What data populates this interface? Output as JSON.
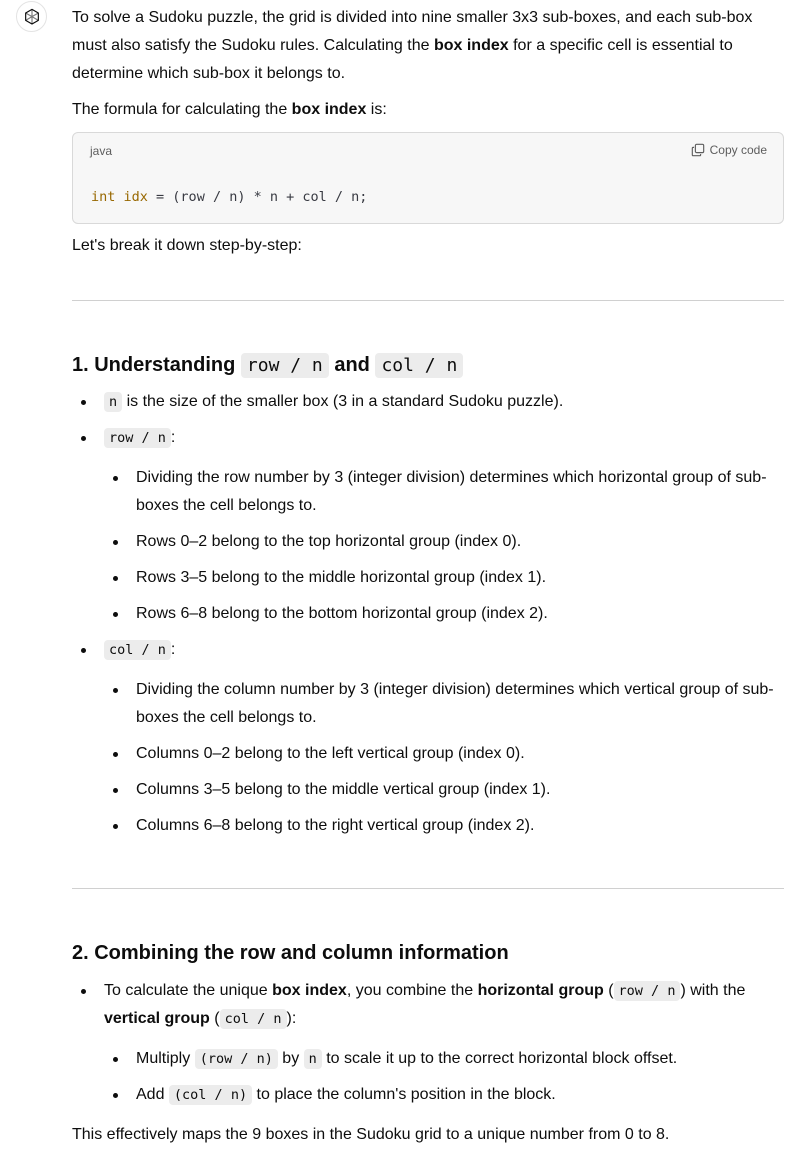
{
  "assistant": {
    "avatar_icon": "openai-logo-icon"
  },
  "intro": {
    "p1_before": "To solve a Sudoku puzzle, the grid is divided into nine smaller 3x3 sub-boxes, and each sub-box must also satisfy the Sudoku rules. Calculating the ",
    "p1_bold": "box index",
    "p1_after": " for a specific cell is essential to determine which sub-box it belongs to.",
    "p2_before": "The formula for calculating the ",
    "p2_bold": "box index",
    "p2_after": " is:"
  },
  "code_block": {
    "language": "java",
    "copy_label": "Copy code",
    "tokens": {
      "kw": "int",
      "sp1": " ",
      "var": "idx",
      "rest": " = (row / n) * n + col / n;"
    }
  },
  "breakdown_text": "Let's break it down step-by-step:",
  "section1": {
    "heading_prefix": "1. Understanding ",
    "heading_code1": "row / n",
    "heading_mid": " and ",
    "heading_code2": "col / n",
    "items": [
      {
        "code": "n",
        "text": " is the size of the smaller box (3 in a standard Sudoku puzzle)."
      },
      {
        "code": "row / n",
        "suffix": ":",
        "sub": [
          "Dividing the row number by 3 (integer division) determines which horizontal group of sub-boxes the cell belongs to.",
          "Rows 0–2 belong to the top horizontal group (index 0).",
          "Rows 3–5 belong to the middle horizontal group (index 1).",
          "Rows 6–8 belong to the bottom horizontal group (index 2)."
        ]
      },
      {
        "code": "col / n",
        "suffix": ":",
        "sub": [
          "Dividing the column number by 3 (integer division) determines which vertical group of sub-boxes the cell belongs to.",
          "Columns 0–2 belong to the left vertical group (index 0).",
          "Columns 3–5 belong to the middle vertical group (index 1).",
          "Columns 6–8 belong to the right vertical group (index 2)."
        ]
      }
    ]
  },
  "section2": {
    "heading": "2. Combining the row and column information",
    "item": {
      "t1": "To calculate the unique ",
      "b1": "box index",
      "t2": ", you combine the ",
      "b2": "horizontal group",
      "t3": " (",
      "c1": "row / n",
      "t4": ") with the ",
      "b3": "vertical group",
      "t5": " (",
      "c2": "col / n",
      "t6": "):"
    },
    "sub": [
      {
        "t1": "Multiply ",
        "c1": "(row / n)",
        "t2": " by ",
        "c2": "n",
        "t3": " to scale it up to the correct horizontal block offset."
      },
      {
        "t1": "Add ",
        "c1": "(col / n)",
        "t2": " to place the column's position in the block."
      }
    ]
  },
  "closing": "This effectively maps the 9 boxes in the Sudoku grid to a unique number from 0 to 8."
}
